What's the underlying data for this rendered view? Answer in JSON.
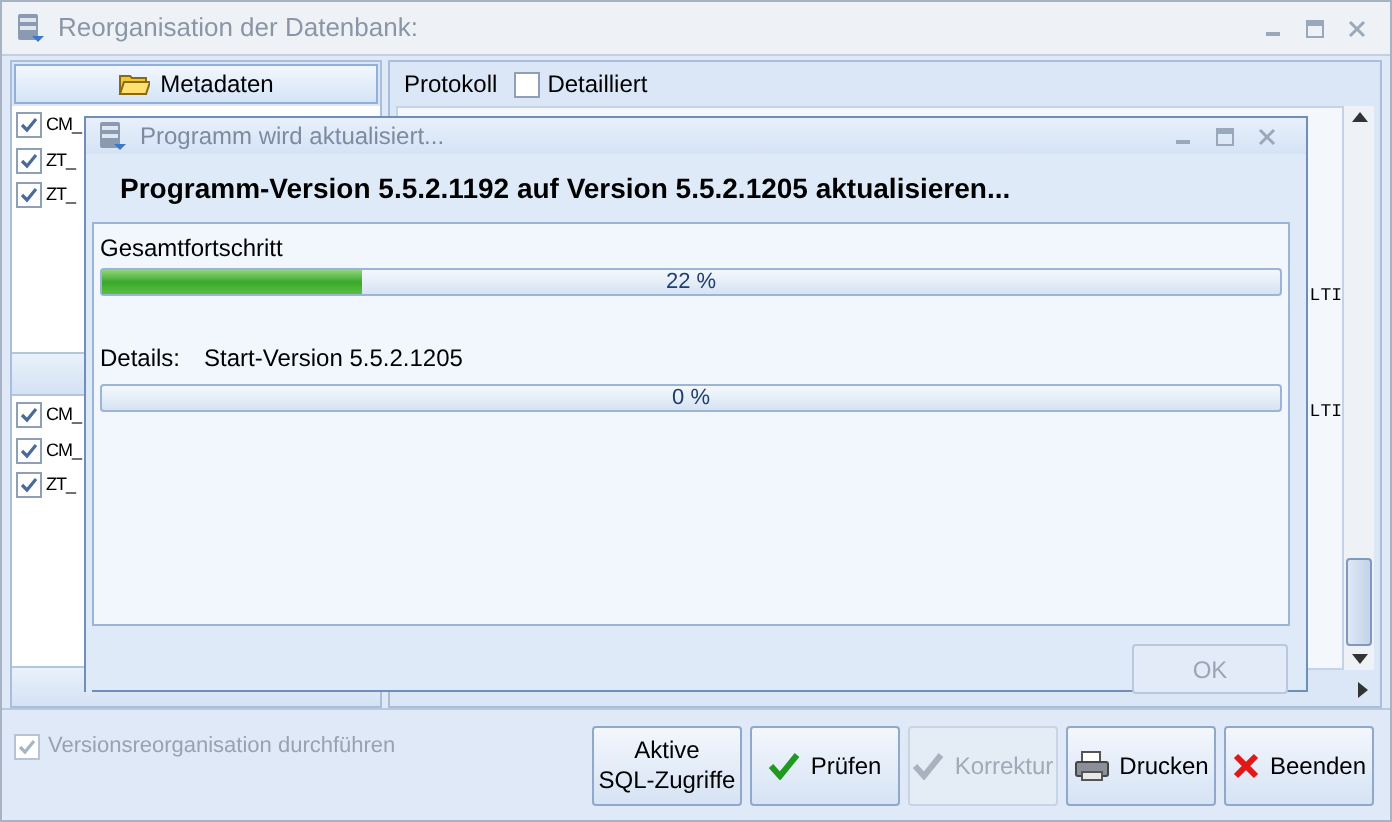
{
  "window": {
    "title": "Reorganisation der Datenbank:"
  },
  "left_panel": {
    "header_button": "Metadaten",
    "lists": [
      {
        "items": [
          {
            "label": "CM_",
            "checked": true
          },
          {
            "label": "ZT_",
            "checked": true
          },
          {
            "label": "ZT_",
            "checked": true
          }
        ]
      },
      {
        "items": [
          {
            "label": "CM_",
            "checked": true
          },
          {
            "label": "CM_",
            "checked": true
          },
          {
            "label": "ZT_",
            "checked": true
          }
        ]
      }
    ]
  },
  "right_panel": {
    "tab_label": "Protokoll",
    "detailed": {
      "label": "Detailliert",
      "checked": false
    },
    "log_lines": [
      "LTI",
      "LTI"
    ]
  },
  "dialog": {
    "title": "Programm wird aktualisiert...",
    "heading": "Programm-Version 5.5.2.1192 auf Version 5.5.2.1205 aktualisieren...",
    "overall": {
      "label": "Gesamtfortschritt",
      "level": 0.22,
      "reading": "22 %"
    },
    "details": {
      "label": "Details:",
      "value": "Start-Version 5.5.2.1205",
      "level": 0,
      "reading": "0 %"
    },
    "ok": {
      "label": "OK",
      "disabled": true
    }
  },
  "bottom": {
    "checkbox": {
      "label": "Versionsreorganisation durchführen",
      "checked": true,
      "disabled": true
    },
    "buttons": [
      {
        "label": "Aktive\nSQL-Zugriffe",
        "kind": "plain",
        "disabled": false
      },
      {
        "label": "Prüfen",
        "kind": "confirm",
        "disabled": false
      },
      {
        "label": "Korrektur",
        "kind": "confirm",
        "disabled": true
      },
      {
        "label": "Drucken",
        "kind": "print",
        "disabled": false
      },
      {
        "label": "Beenden",
        "kind": "quit",
        "disabled": false
      }
    ]
  }
}
